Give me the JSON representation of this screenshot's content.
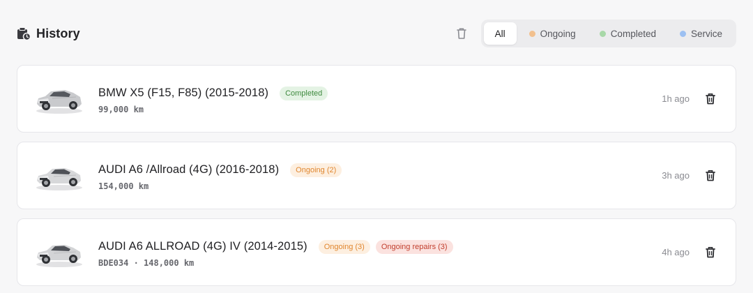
{
  "header": {
    "title": "History",
    "title_icon": "history-clipboard-icon",
    "clear_icon": "trash-icon"
  },
  "filters": [
    {
      "label": "All",
      "active": true,
      "dot_color": null
    },
    {
      "label": "Ongoing",
      "active": false,
      "dot_color": "#f2c08e"
    },
    {
      "label": "Completed",
      "active": false,
      "dot_color": "#a8d8a8"
    },
    {
      "label": "Service",
      "active": false,
      "dot_color": "#9cc0f2"
    }
  ],
  "rows": [
    {
      "name": "BMW X5 (F15, F85) (2015-2018)",
      "meta": "99,000 km",
      "time": "1h ago",
      "badges": [
        {
          "label": "Completed",
          "kind": "completed"
        }
      ]
    },
    {
      "name": "AUDI A6 /Allroad (4G) (2016-2018)",
      "meta": "154,000 km",
      "time": "3h ago",
      "badges": [
        {
          "label": "Ongoing (2)",
          "kind": "ongoing"
        }
      ]
    },
    {
      "name": "AUDI A6 ALLROAD (4G) IV (2014-2015)",
      "meta": "BDE034 · 148,000 km",
      "time": "4h ago",
      "badges": [
        {
          "label": "Ongoing (3)",
          "kind": "ongoing"
        },
        {
          "label": "Ongoing repairs (3)",
          "kind": "repairs"
        }
      ]
    }
  ],
  "colors": {
    "completed_text": "#3f8a3f",
    "ongoing_text": "#e0862e",
    "repairs_text": "#c2402f"
  }
}
